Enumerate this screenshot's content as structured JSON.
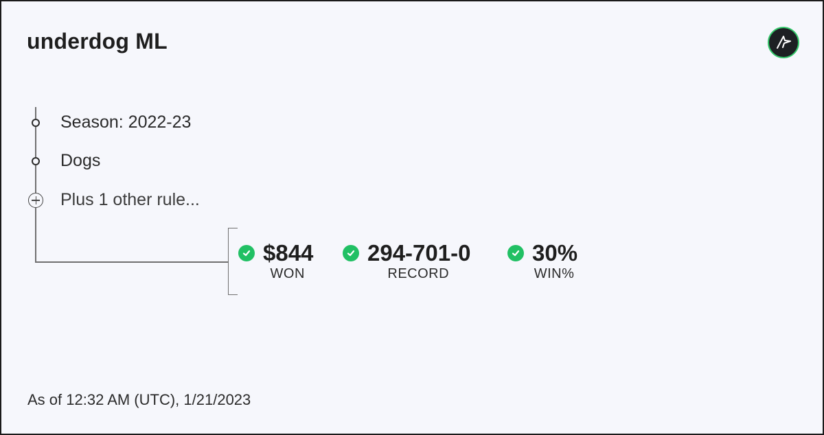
{
  "title": "underdog ML",
  "logo": {
    "icon": "brand-logo-icon",
    "accent": "#35c76a"
  },
  "rules": [
    {
      "text": "Season: 2022-23",
      "icon": "circle-bullet-icon"
    },
    {
      "text": "Dogs",
      "icon": "circle-bullet-icon"
    },
    {
      "text": "Plus 1 other rule...",
      "icon": "plus-circle-icon"
    }
  ],
  "stats": [
    {
      "value": "$844",
      "label": "WON",
      "icon": "check-circle-icon"
    },
    {
      "value": "294-701-0",
      "label": "RECORD",
      "icon": "check-circle-icon"
    },
    {
      "value": "30%",
      "label": "WIN%",
      "icon": "check-circle-icon"
    }
  ],
  "as_of": "As of 12:32 AM (UTC), 1/21/2023",
  "colors": {
    "success": "#21c064",
    "background": "#f6f7fc",
    "text": "#1e1e1e"
  }
}
